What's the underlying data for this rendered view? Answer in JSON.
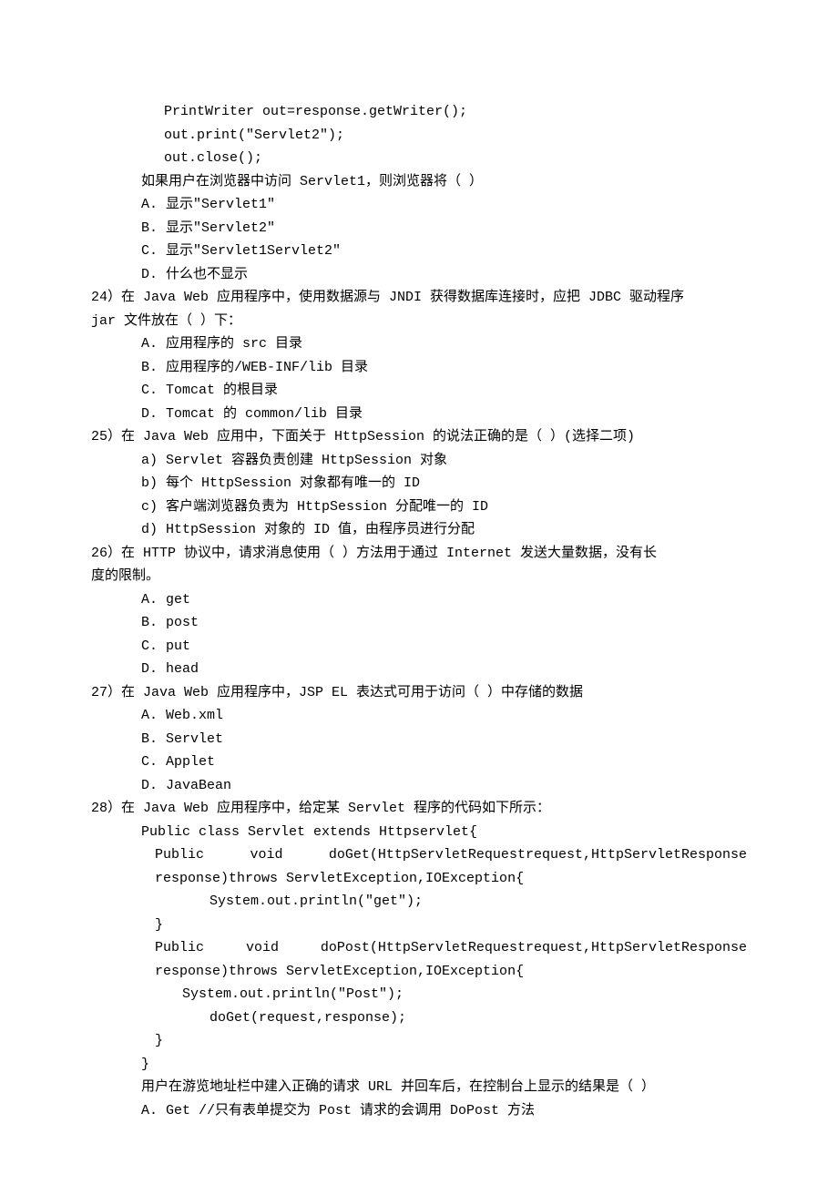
{
  "code_block_top": {
    "l1": "PrintWriter out=response.getWriter();",
    "l2": "out.print(\"Servlet2\");",
    "l3": "out.close();"
  },
  "intro23": "如果用户在浏览器中访问 Servlet1，则浏览器将（  ）",
  "q23": {
    "a": "A.  显示\"Servlet1\"",
    "b": "B.  显示\"Servlet2\"",
    "c": "C.  显示\"Servlet1Servlet2\"",
    "d": "D.  什么也不显示"
  },
  "q24": {
    "stem1": "24）在 Java Web 应用程序中，使用数据源与 JNDI 获得数据库连接时，应把 JDBC 驱动程序",
    "stem2": "jar 文件放在（ ）下：",
    "a": "A.  应用程序的 src 目录",
    "b": "B.  应用程序的/WEB-INF/lib 目录",
    "c": "C.  Tomcat 的根目录",
    "d": "D.  Tomcat 的 common/lib 目录"
  },
  "q25": {
    "stem": "25）在 Java Web 应用中，下面关于 HttpSession 的说法正确的是（  ）(选择二项)",
    "a": "a)  Servlet 容器负责创建 HttpSession 对象",
    "b": "b)  每个 HttpSession 对象都有唯一的 ID",
    "c": "c)  客户端浏览器负责为 HttpSession 分配唯一的 ID",
    "d": "d)  HttpSession 对象的 ID 值，由程序员进行分配"
  },
  "q26": {
    "stem1": "26）在 HTTP 协议中，请求消息使用（   ）方法用于通过 Internet 发送大量数据，没有长",
    "stem2": "度的限制。",
    "a": "A.  get",
    "b": "B.  post",
    "c": "C.  put",
    "d": "D.  head"
  },
  "q27": {
    "stem": "27）在 Java Web 应用程序中，JSP EL 表达式可用于访问（ ）中存储的数据",
    "a": "A.  Web.xml",
    "b": "B.  Servlet",
    "c": "C.  Applet",
    "d": "D.  JavaBean"
  },
  "q28": {
    "stem": "28）在 Java Web 应用程序中，给定某 Servlet 程序的代码如下所示：",
    "c1": "Public class Servlet extends Httpservlet{",
    "c2a": "Public",
    "c2b": "void",
    "c2c": "doGet(HttpServletRequestrequest,HttpServletResponse",
    "c3": "response)throws ServletException,IOException{",
    "c4": "System.out.println(\"get\");",
    "c5": "}",
    "c6a": "Public",
    "c6b": "void",
    "c6c": "doPost(HttpServletRequestrequest,HttpServletResponse",
    "c7": "response)throws ServletException,IOException{",
    "c8": "System.out.println(\"Post\");",
    "c9": "doGet(request,response);",
    "c10": "}",
    "c11": "}",
    "tail": "用户在游览地址栏中建入正确的请求 URL 并回车后，在控制台上显示的结果是（  ）",
    "a": "A.  Get     //只有表单提交为 Post 请求的会调用 DoPost 方法"
  }
}
